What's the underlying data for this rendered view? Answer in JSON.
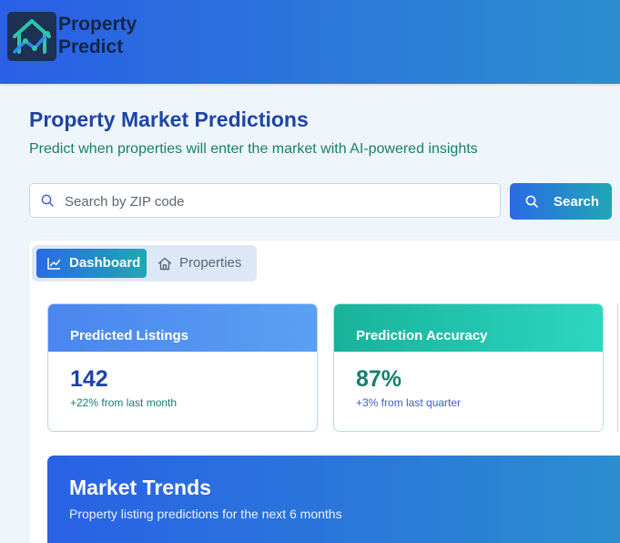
{
  "brand": {
    "name_line1": "Property",
    "name_line2": "Predict"
  },
  "page": {
    "title": "Property Market Predictions",
    "subtitle": "Predict when properties will enter the market with AI-powered insights"
  },
  "search": {
    "placeholder": "Search by ZIP code",
    "value": "",
    "button_label": "Search"
  },
  "tabs": [
    {
      "label": "Dashboard",
      "icon": "line-chart-icon",
      "active": true
    },
    {
      "label": "Properties",
      "icon": "home-icon",
      "active": false
    }
  ],
  "cards": {
    "listings": {
      "title": "Predicted Listings",
      "value": "142",
      "change": "+22% from last month"
    },
    "accuracy": {
      "title": "Prediction Accuracy",
      "value": "87%",
      "change": "+3% from last quarter"
    }
  },
  "trends": {
    "title": "Market Trends",
    "subtitle": "Property listing predictions for the next 6 months"
  },
  "colors": {
    "header_start": "#2a5fe6",
    "header_end": "#2b8fcf",
    "title_blue": "#1f44a8",
    "accent_teal": "#17806f"
  }
}
